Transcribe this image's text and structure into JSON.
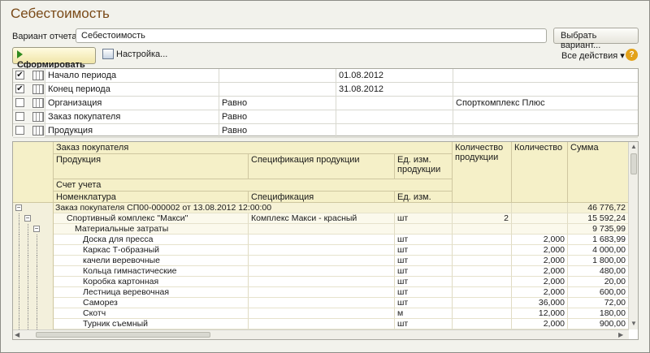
{
  "window": {
    "title": "Себестоимость"
  },
  "variant": {
    "label": "Вариант отчета:",
    "value": "Себестоимость",
    "select_button": "Выбрать вариант..."
  },
  "toolbar": {
    "form_button": "Сформировать",
    "settings": "Настройка...",
    "all_actions": "Все действия",
    "help": "?"
  },
  "filters": [
    {
      "checked": true,
      "name": "Начало периода",
      "comparison": "",
      "value": "01.08.2012"
    },
    {
      "checked": true,
      "name": "Конец периода",
      "comparison": "",
      "value": "31.08.2012"
    },
    {
      "checked": false,
      "name": "Организация",
      "comparison": "Равно",
      "value": "Спорткомплекс Плюс"
    },
    {
      "checked": false,
      "name": "Заказ покупателя",
      "comparison": "Равно",
      "value": ""
    },
    {
      "checked": false,
      "name": "Продукция",
      "comparison": "Равно",
      "value": ""
    }
  ],
  "report_header": {
    "order": "Заказ покупателя",
    "product": "Продукция",
    "spec_product": "Спецификация продукции",
    "unit_product": "Ед. изм. продукции",
    "qty_product": "Количество продукции",
    "qty": "Количество",
    "sum": "Сумма",
    "account": "Счет учета",
    "nomenclature": "Номенклатура",
    "spec": "Спецификация",
    "unit": "Ед. изм."
  },
  "rows": [
    {
      "level": 0,
      "name": "Заказ покупателя СП00-000002 от 13.08.2012 12:00:00",
      "spec": "",
      "unit": "",
      "qp": "",
      "qty": "",
      "sum": "46 776,72",
      "toggle": "−"
    },
    {
      "level": 1,
      "name": "Спортивный комплекс \"Макси\"",
      "spec": "Комплекс Макси - красный",
      "unit": "шт",
      "qp": "2",
      "qty": "",
      "sum": "15 592,24",
      "toggle": "−"
    },
    {
      "level": 2,
      "name": "Материальные затраты",
      "spec": "",
      "unit": "",
      "qp": "",
      "qty": "",
      "sum": "9 735,99",
      "toggle": "−"
    },
    {
      "level": 3,
      "name": "Доска для пресса",
      "spec": "",
      "unit": "шт",
      "qp": "",
      "qty": "2,000",
      "sum": "1 683,99"
    },
    {
      "level": 3,
      "name": "Каркас Т-образный",
      "spec": "",
      "unit": "шт",
      "qp": "",
      "qty": "2,000",
      "sum": "4 000,00"
    },
    {
      "level": 3,
      "name": "качели веревочные",
      "spec": "",
      "unit": "шт",
      "qp": "",
      "qty": "2,000",
      "sum": "1 800,00"
    },
    {
      "level": 3,
      "name": "Кольца гимнастические",
      "spec": "",
      "unit": "шт",
      "qp": "",
      "qty": "2,000",
      "sum": "480,00"
    },
    {
      "level": 3,
      "name": "Коробка картонная",
      "spec": "",
      "unit": "шт",
      "qp": "",
      "qty": "2,000",
      "sum": "20,00"
    },
    {
      "level": 3,
      "name": "Лестница веревочная",
      "spec": "",
      "unit": "шт",
      "qp": "",
      "qty": "2,000",
      "sum": "600,00"
    },
    {
      "level": 3,
      "name": "Саморез",
      "spec": "",
      "unit": "шт",
      "qp": "",
      "qty": "36,000",
      "sum": "72,00"
    },
    {
      "level": 3,
      "name": "Скотч",
      "spec": "",
      "unit": "м",
      "qp": "",
      "qty": "12,000",
      "sum": "180,00"
    },
    {
      "level": 3,
      "name": "Турник съемный",
      "spec": "",
      "unit": "шт",
      "qp": "",
      "qty": "2,000",
      "sum": "900,00"
    }
  ]
}
